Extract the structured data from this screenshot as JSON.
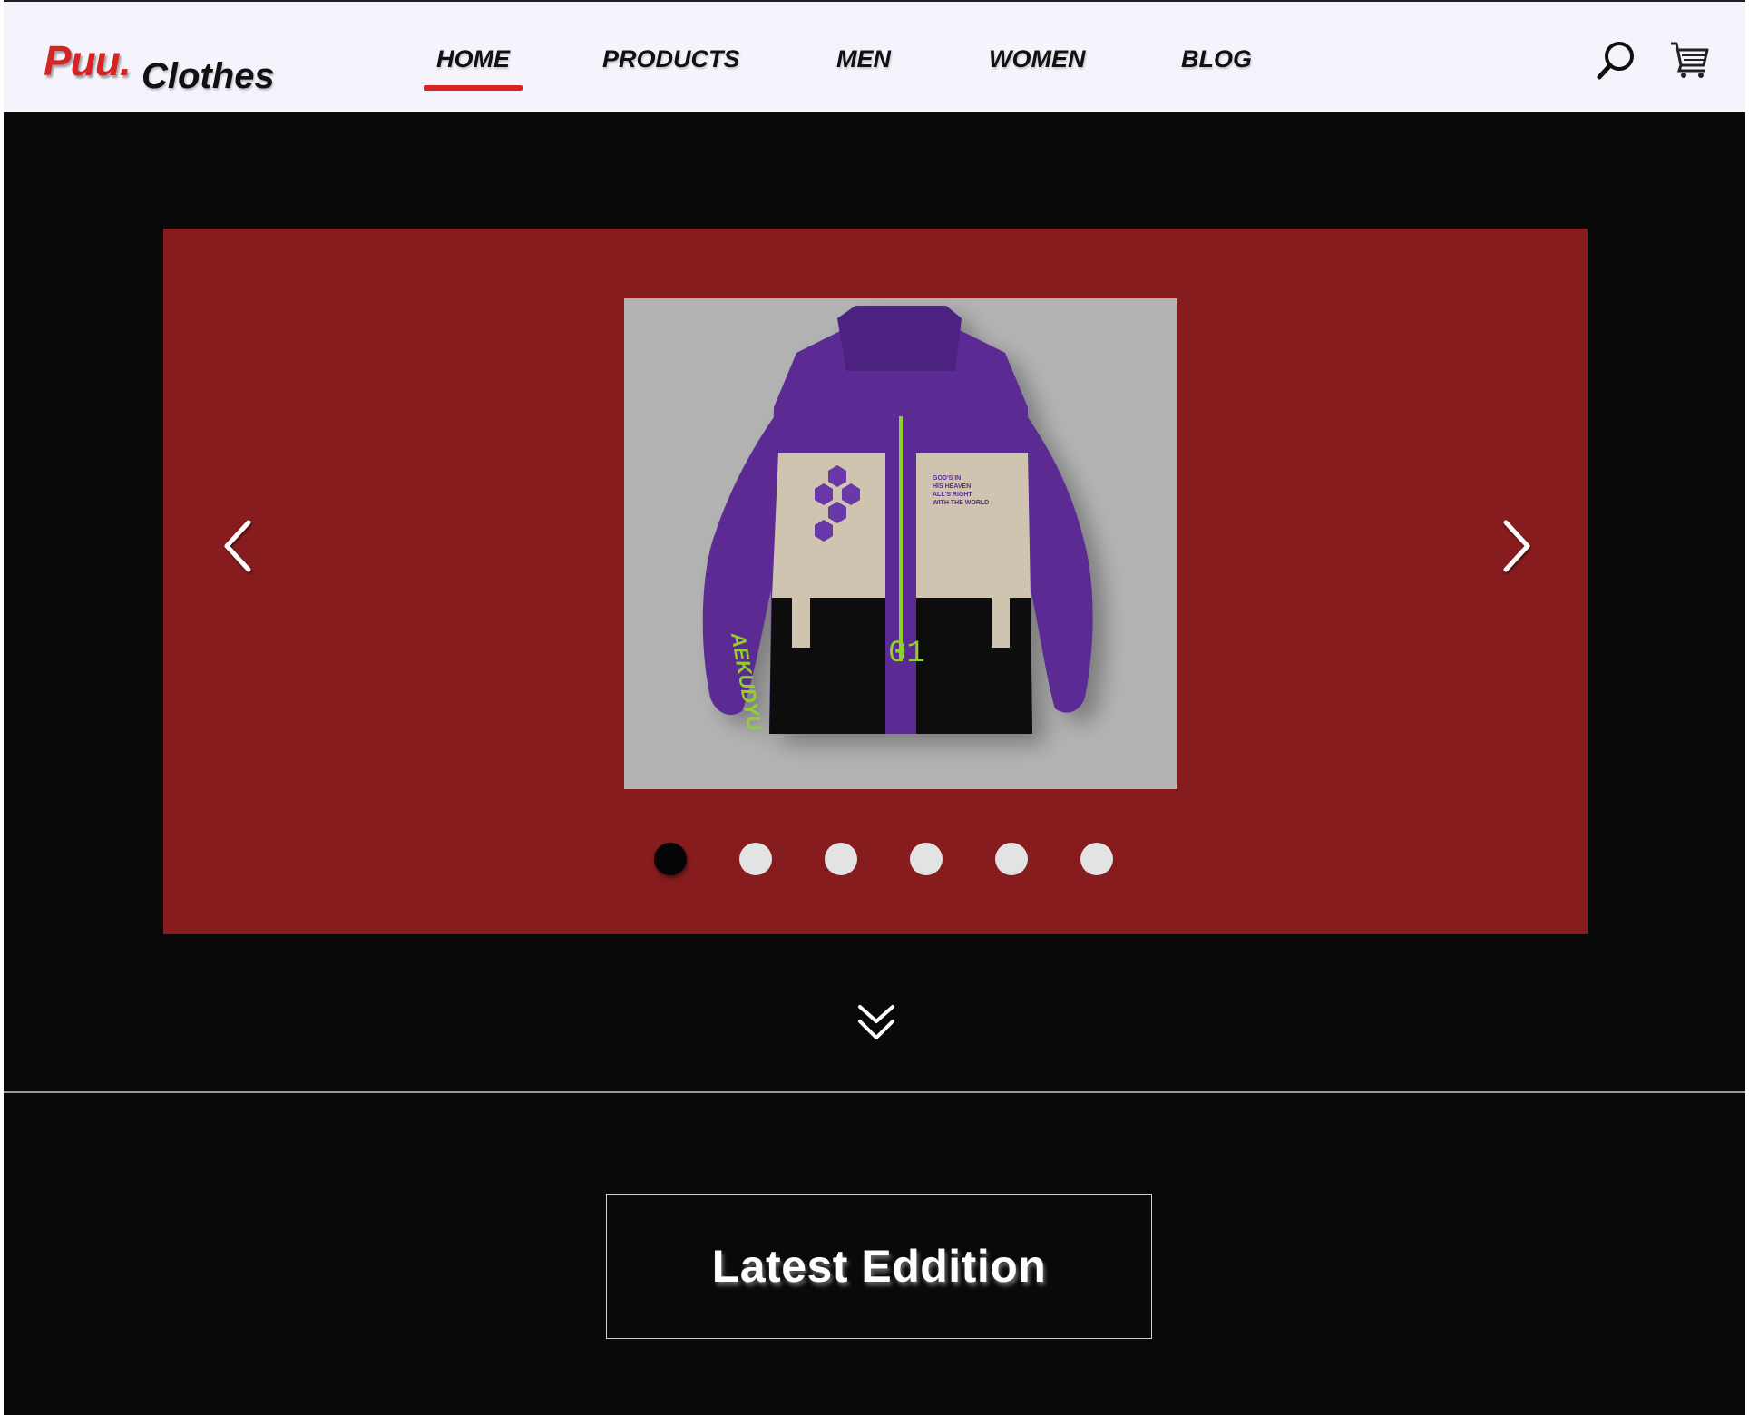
{
  "brand": {
    "name_part1": "Puu.",
    "name_part2": "Clothes",
    "accent_color": "#d42424"
  },
  "nav": {
    "items": [
      {
        "label": "HOME",
        "active": true
      },
      {
        "label": "PRODUCTS",
        "active": false
      },
      {
        "label": "MEN",
        "active": false
      },
      {
        "label": "WOMEN",
        "active": false
      },
      {
        "label": "BLOG",
        "active": false
      }
    ]
  },
  "header_icons": {
    "search": "search-icon",
    "cart": "cart-icon"
  },
  "carousel": {
    "background_color": "#861c1d",
    "slide_count": 6,
    "active_slide": 1,
    "image_subject": "jacket-image",
    "jacket_text": {
      "chest_lines": [
        "GOD'S IN",
        "HIS HEAVEN",
        "ALL'S RIGHT",
        "WITH THE WORLD"
      ],
      "zip_number": "01",
      "sleeve_text": "AEKUDYU"
    },
    "prev_icon": "chevron-left-icon",
    "next_icon": "chevron-right-icon"
  },
  "scroll_icon": "double-chevron-down-icon",
  "section": {
    "title": "Latest Eddition"
  }
}
